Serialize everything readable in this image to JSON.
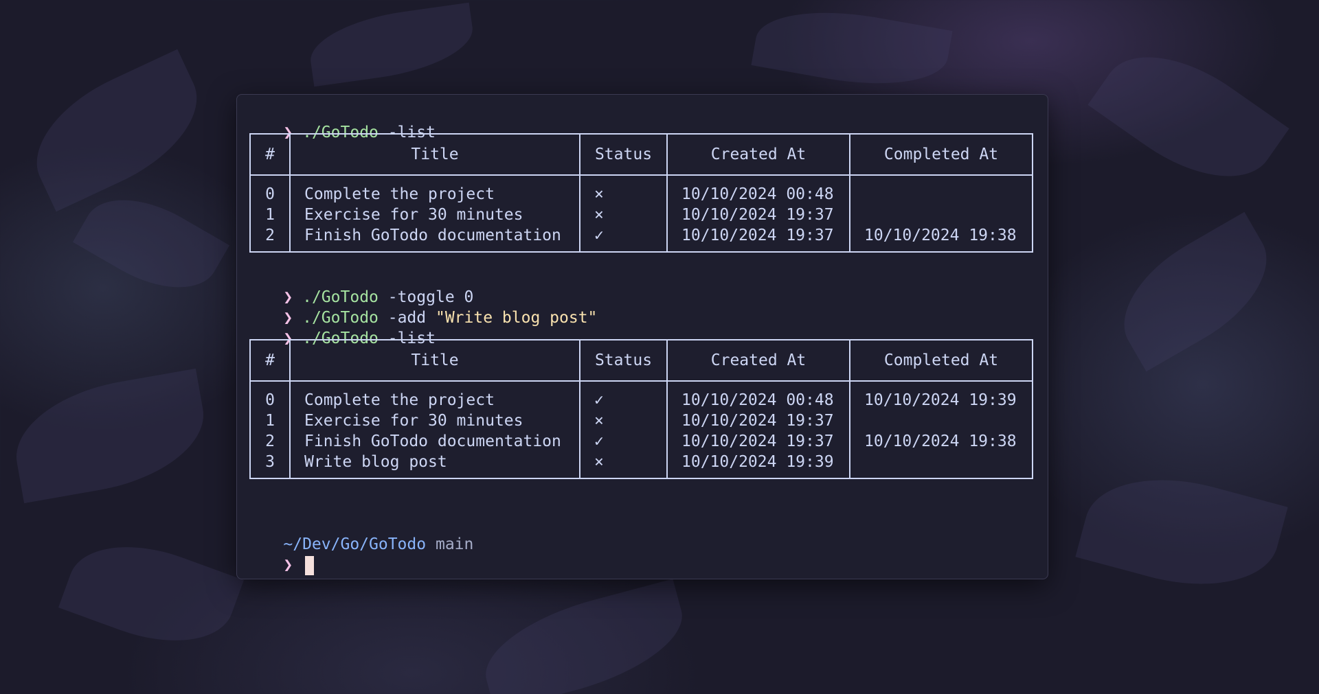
{
  "prompt_symbol": "❯",
  "commands": [
    {
      "program": "./GoTodo",
      "args": " -list",
      "string": ""
    },
    {
      "program": "./GoTodo",
      "args": " -toggle 0",
      "string": ""
    },
    {
      "program": "./GoTodo",
      "args": " -add ",
      "string": "\"Write blog post\""
    },
    {
      "program": "./GoTodo",
      "args": " -list",
      "string": ""
    }
  ],
  "table_headers": {
    "num": "#",
    "title": "Title",
    "status": "Status",
    "created": "Created At",
    "completed": "Completed At"
  },
  "table1_rows": [
    {
      "num": "0",
      "title": "Complete the project",
      "status": "×",
      "created": "10/10/2024 00:48",
      "completed": ""
    },
    {
      "num": "1",
      "title": "Exercise for 30 minutes",
      "status": "×",
      "created": "10/10/2024 19:37",
      "completed": ""
    },
    {
      "num": "2",
      "title": "Finish GoTodo documentation",
      "status": "✓",
      "created": "10/10/2024 19:37",
      "completed": "10/10/2024 19:38"
    }
  ],
  "table2_rows": [
    {
      "num": "0",
      "title": "Complete the project",
      "status": "✓",
      "created": "10/10/2024 00:48",
      "completed": "10/10/2024 19:39"
    },
    {
      "num": "1",
      "title": "Exercise for 30 minutes",
      "status": "×",
      "created": "10/10/2024 19:37",
      "completed": ""
    },
    {
      "num": "2",
      "title": "Finish GoTodo documentation",
      "status": "✓",
      "created": "10/10/2024 19:37",
      "completed": "10/10/2024 19:38"
    },
    {
      "num": "3",
      "title": "Write blog post",
      "status": "×",
      "created": "10/10/2024 19:39",
      "completed": ""
    }
  ],
  "footer": {
    "path": "~/Dev/Go/GoTodo",
    "branch": "main"
  },
  "colors": {
    "prompt": "#f5c2e7",
    "command": "#a6e3a1",
    "string": "#f9e2af",
    "path": "#89b4fa",
    "terminal_bg": "#1e1e2e",
    "text": "#cdd6f4"
  }
}
